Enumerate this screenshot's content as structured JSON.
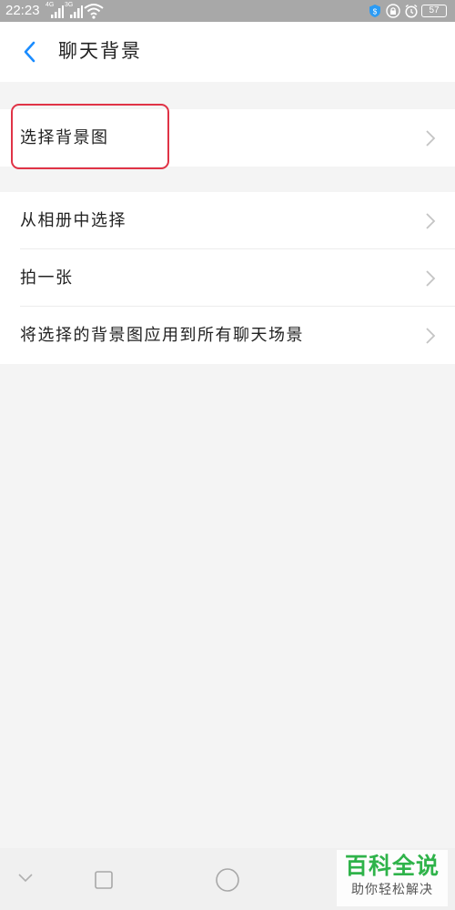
{
  "status_bar": {
    "time": "22:23",
    "signal1_tag": "4G",
    "signal2_tag": "3G",
    "battery": "57",
    "icons": [
      "shield-icon",
      "lock-icon",
      "alarm-icon"
    ]
  },
  "header": {
    "title": "聊天背景",
    "back_icon": "chevron-left-icon"
  },
  "sections": {
    "first": {
      "items": [
        {
          "label": "选择背景图"
        }
      ]
    },
    "second": {
      "items": [
        {
          "label": "从相册中选择"
        },
        {
          "label": "拍一张"
        },
        {
          "label": "将选择的背景图应用到所有聊天场景"
        }
      ]
    }
  },
  "nav_bar": {
    "icons": [
      "chevron-down-icon",
      "square-icon",
      "circle-icon"
    ]
  },
  "watermark": {
    "title": "百科全说",
    "subtitle": "助你轻松解决"
  },
  "colors": {
    "accent": "#1a8cff",
    "highlight": "#e03346",
    "watermark_green": "#2fb34a",
    "status_bar": "#a8a8a8",
    "background": "#f4f4f4"
  }
}
